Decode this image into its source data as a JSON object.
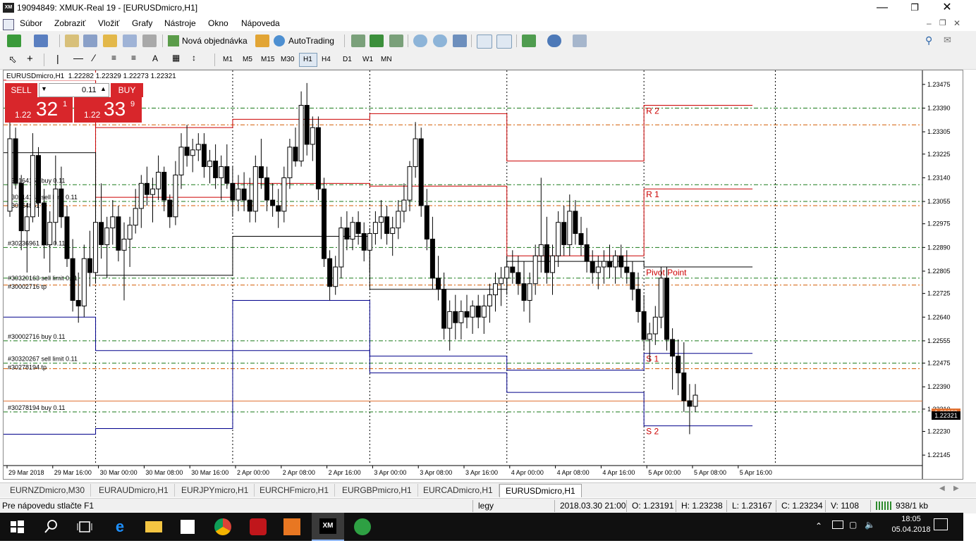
{
  "window": {
    "title": "19094849: XMUK-Real 19 - [EURUSDmicro,H1]",
    "app_icon": "XM"
  },
  "menu": [
    "Súbor",
    "Zobraziť",
    "Vložiť",
    "Grafy",
    "Nástroje",
    "Okno",
    "Nápoveda"
  ],
  "toolbar": {
    "new_order": "Nová objednávka",
    "autotrading": "AutoTrading",
    "timeframes": [
      "M1",
      "M5",
      "M15",
      "M30",
      "H1",
      "H4",
      "D1",
      "W1",
      "MN"
    ],
    "active_timeframe": "H1"
  },
  "chart": {
    "header": "EURUSDmicro,H1  1.22282 1.22329 1.22273 1.22321",
    "symbol": "EURUSDmicro,H1",
    "current_price": "1.22321",
    "ask_price": "1.22339",
    "colors": {
      "bull": "#ffffff",
      "bear": "#000000",
      "resistance": "#cc0000",
      "support": "#00008b",
      "pivot": "#000000",
      "buy_line": "#1a7a1a",
      "sell_limit_line": "#1a7a1a",
      "tp_line": "#d45a00",
      "ask_line": "#e07030"
    },
    "pivot_labels": {
      "r2": "R 2",
      "r1": "R 1",
      "pivot": "Pivot Point",
      "s1": "S 1",
      "s2": "S 2"
    },
    "order_labels": [
      {
        "text": "#30164159 buy 0.11",
        "price": 1.23115
      },
      {
        "text": "#30214147 sell limit 0.11",
        "price": 1.23055
      },
      {
        "text": "#30164861 tp",
        "price": 1.23055
      },
      {
        "text": "#30236961 buy 0.11",
        "price": 1.2289
      },
      {
        "text": "#30320163 sell limit 0.11",
        "price": 1.22765
      },
      {
        "text": "#30002716 tp",
        "price": 1.22765
      },
      {
        "text": "#30002716 buy 0.11",
        "price": 1.22555
      },
      {
        "text": "#30320267 sell limit 0.11",
        "price": 1.22475
      },
      {
        "text": "#30278194 tp",
        "price": 1.22475
      },
      {
        "text": "#30278194 buy 0.11",
        "price": 1.223
      }
    ]
  },
  "trade_panel": {
    "sell_label": "SELL",
    "buy_label": "BUY",
    "lot": "0.11",
    "sell_prefix": "1.22",
    "sell_big": "32",
    "sell_sup": "1",
    "buy_prefix": "1.22",
    "buy_big": "33",
    "buy_sup": "9"
  },
  "chart_data": {
    "type": "candlestick",
    "symbol": "EURUSDmicro",
    "timeframe": "H1",
    "ylim": [
      1.2211,
      1.2351
    ],
    "y_ticks": [
      "1.23475",
      "1.23390",
      "1.23305",
      "1.23225",
      "1.23140",
      "1.23055",
      "1.22975",
      "1.22890",
      "1.22805",
      "1.22725",
      "1.22640",
      "1.22555",
      "1.22475",
      "1.22390",
      "1.22310",
      "1.22230",
      "1.22145"
    ],
    "x_ticks": [
      "29 Mar 2018",
      "29 Mar 16:00",
      "30 Mar 00:00",
      "30 Mar 08:00",
      "30 Mar 16:00",
      "2 Apr 00:00",
      "2 Apr 08:00",
      "2 Apr 16:00",
      "3 Apr 00:00",
      "3 Apr 08:00",
      "3 Apr 16:00",
      "4 Apr 00:00",
      "4 Apr 08:00",
      "4 Apr 16:00",
      "5 Apr 00:00",
      "5 Apr 08:00",
      "5 Apr 16:00"
    ],
    "day_separators": [
      15.5,
      39.5,
      63.5,
      87.5,
      111.5
    ],
    "pivots": [
      {
        "from": -1,
        "to": 15.5,
        "r2": 1.2366,
        "r1": 1.2349,
        "pp": 1.2323,
        "s1": 1.2264,
        "s2": 1.2222
      },
      {
        "from": 15.5,
        "to": 39.5,
        "r2": 1.2332,
        "r1": 1.2307,
        "pp": 1.2279,
        "s1": 1.2252,
        "s2": 1.2224
      },
      {
        "from": 39.5,
        "to": 63.5,
        "r2": 1.2335,
        "r1": 1.2312,
        "pp": 1.2293,
        "s1": 1.227,
        "s2": 1.2252
      },
      {
        "from": 63.5,
        "to": 87.5,
        "r2": 1.2337,
        "r1": 1.2311,
        "pp": 1.2274,
        "s1": 1.225,
        "s2": 1.2244
      },
      {
        "from": 87.5,
        "to": 111.5,
        "r2": 1.232,
        "r1": 1.2286,
        "pp": 1.2284,
        "s1": 1.2245,
        "s2": 1.2237
      },
      {
        "from": 111.5,
        "to": 130.5,
        "r2": 1.234,
        "r1": 1.231,
        "pp": 1.2282,
        "s1": 1.2251,
        "s2": 1.2225
      }
    ],
    "order_lines": [
      {
        "price": 1.2339,
        "kind": "buy"
      },
      {
        "price": 1.2333,
        "kind": "tp"
      },
      {
        "price": 1.23115,
        "kind": "buy"
      },
      {
        "price": 1.23055,
        "kind": "sell_limit"
      },
      {
        "price": 1.2304,
        "kind": "tp"
      },
      {
        "price": 1.2289,
        "kind": "buy"
      },
      {
        "price": 1.2278,
        "kind": "sell_limit"
      },
      {
        "price": 1.22755,
        "kind": "tp"
      },
      {
        "price": 1.22555,
        "kind": "buy"
      },
      {
        "price": 1.22475,
        "kind": "sell_limit"
      },
      {
        "price": 1.22455,
        "kind": "tp"
      },
      {
        "price": 1.223,
        "kind": "buy"
      }
    ],
    "ask_line": 1.22339,
    "candles": [
      [
        1.2302,
        1.2335,
        1.23,
        1.2328
      ],
      [
        1.2328,
        1.2332,
        1.231,
        1.2312
      ],
      [
        1.2312,
        1.2315,
        1.2288,
        1.2295
      ],
      [
        1.2295,
        1.2305,
        1.228,
        1.23
      ],
      [
        1.23,
        1.233,
        1.2298,
        1.2322
      ],
      [
        1.2322,
        1.2325,
        1.23,
        1.2305
      ],
      [
        1.2305,
        1.231,
        1.2285,
        1.229
      ],
      [
        1.229,
        1.2302,
        1.228,
        1.2298
      ],
      [
        1.2298,
        1.2322,
        1.229,
        1.231
      ],
      [
        1.231,
        1.2318,
        1.2296,
        1.23
      ],
      [
        1.23,
        1.2304,
        1.2282,
        1.2285
      ],
      [
        1.2285,
        1.2292,
        1.2266,
        1.227
      ],
      [
        1.227,
        1.228,
        1.2262,
        1.2268
      ],
      [
        1.2268,
        1.229,
        1.2264,
        1.2285
      ],
      [
        1.2285,
        1.2295,
        1.2275,
        1.228
      ],
      [
        1.228,
        1.2305,
        1.2276,
        1.2298
      ],
      [
        1.2298,
        1.2312,
        1.2285,
        1.229
      ],
      [
        1.229,
        1.23,
        1.2278,
        1.2296
      ],
      [
        1.2296,
        1.2306,
        1.229,
        1.23
      ],
      [
        1.23,
        1.2304,
        1.2284,
        1.2288
      ],
      [
        1.2288,
        1.2298,
        1.227,
        1.2292
      ],
      [
        1.2292,
        1.23,
        1.2282,
        1.2297
      ],
      [
        1.2297,
        1.231,
        1.2294,
        1.2303
      ],
      [
        1.2303,
        1.2315,
        1.2296,
        1.2312
      ],
      [
        1.2312,
        1.2318,
        1.2304,
        1.2308
      ],
      [
        1.2308,
        1.2314,
        1.2298,
        1.231
      ],
      [
        1.231,
        1.2322,
        1.2306,
        1.2316
      ],
      [
        1.2316,
        1.2318,
        1.2302,
        1.2306
      ],
      [
        1.2306,
        1.2308,
        1.2296,
        1.23
      ],
      [
        1.23,
        1.232,
        1.2297,
        1.2315
      ],
      [
        1.2315,
        1.233,
        1.231,
        1.2325
      ],
      [
        1.2325,
        1.2333,
        1.2318,
        1.2322
      ],
      [
        1.2322,
        1.2328,
        1.2316,
        1.2324
      ],
      [
        1.2324,
        1.233,
        1.232,
        1.2326
      ],
      [
        1.2326,
        1.233,
        1.2314,
        1.2318
      ],
      [
        1.2318,
        1.2324,
        1.2312,
        1.232
      ],
      [
        1.232,
        1.2326,
        1.231,
        1.2314
      ],
      [
        1.2314,
        1.2322,
        1.2306,
        1.2318
      ],
      [
        1.2318,
        1.2326,
        1.231,
        1.2312
      ],
      [
        1.2312,
        1.2318,
        1.23,
        1.2306
      ],
      [
        1.2306,
        1.2315,
        1.2302,
        1.231
      ],
      [
        1.231,
        1.2316,
        1.2302,
        1.2306
      ],
      [
        1.2306,
        1.2314,
        1.2298,
        1.2302
      ],
      [
        1.2302,
        1.2322,
        1.2298,
        1.2318
      ],
      [
        1.2318,
        1.2328,
        1.231,
        1.2314
      ],
      [
        1.2314,
        1.2318,
        1.2302,
        1.2306
      ],
      [
        1.2306,
        1.2312,
        1.23,
        1.2304
      ],
      [
        1.2304,
        1.231,
        1.2296,
        1.2302
      ],
      [
        1.2302,
        1.2318,
        1.2298,
        1.2314
      ],
      [
        1.2314,
        1.2328,
        1.231,
        1.2325
      ],
      [
        1.2325,
        1.2332,
        1.2318,
        1.232
      ],
      [
        1.232,
        1.2345,
        1.2318,
        1.234
      ],
      [
        1.234,
        1.2348,
        1.2322,
        1.2326
      ],
      [
        1.2326,
        1.2336,
        1.232,
        1.2332
      ],
      [
        1.2332,
        1.2336,
        1.2306,
        1.231
      ],
      [
        1.231,
        1.2314,
        1.2282,
        1.2285
      ],
      [
        1.2285,
        1.2288,
        1.227,
        1.2275
      ],
      [
        1.2275,
        1.2286,
        1.2272,
        1.2282
      ],
      [
        1.2282,
        1.23,
        1.2278,
        1.2296
      ],
      [
        1.2296,
        1.2302,
        1.2288,
        1.2292
      ],
      [
        1.2292,
        1.23,
        1.2288,
        1.2298
      ],
      [
        1.2298,
        1.2302,
        1.229,
        1.2294
      ],
      [
        1.2294,
        1.2298,
        1.2284,
        1.2288
      ],
      [
        1.2288,
        1.2296,
        1.228,
        1.2294
      ],
      [
        1.2294,
        1.2302,
        1.229,
        1.2298
      ],
      [
        1.2298,
        1.2306,
        1.2292,
        1.23
      ],
      [
        1.23,
        1.2304,
        1.229,
        1.2294
      ],
      [
        1.2294,
        1.23,
        1.2286,
        1.2296
      ],
      [
        1.2296,
        1.2306,
        1.2292,
        1.2302
      ],
      [
        1.2302,
        1.2312,
        1.2298,
        1.2306
      ],
      [
        1.2306,
        1.232,
        1.2302,
        1.2318
      ],
      [
        1.2318,
        1.2334,
        1.2314,
        1.2328
      ],
      [
        1.2328,
        1.2332,
        1.23,
        1.2304
      ],
      [
        1.2304,
        1.231,
        1.2288,
        1.2292
      ],
      [
        1.2292,
        1.23,
        1.2274,
        1.2278
      ],
      [
        1.2278,
        1.2286,
        1.227,
        1.2274
      ],
      [
        1.2274,
        1.228,
        1.2256,
        1.226
      ],
      [
        1.226,
        1.227,
        1.2252,
        1.2266
      ],
      [
        1.2266,
        1.2272,
        1.2256,
        1.2262
      ],
      [
        1.2262,
        1.227,
        1.2256,
        1.2266
      ],
      [
        1.2266,
        1.2272,
        1.226,
        1.2264
      ],
      [
        1.2264,
        1.227,
        1.2258,
        1.2268
      ],
      [
        1.2268,
        1.2272,
        1.226,
        1.2264
      ],
      [
        1.2264,
        1.2272,
        1.2258,
        1.2268
      ],
      [
        1.2268,
        1.2276,
        1.2262,
        1.2272
      ],
      [
        1.2272,
        1.228,
        1.2266,
        1.2276
      ],
      [
        1.2276,
        1.2282,
        1.2268,
        1.2278
      ],
      [
        1.2278,
        1.2286,
        1.2272,
        1.2282
      ],
      [
        1.2282,
        1.2288,
        1.2276,
        1.228
      ],
      [
        1.228,
        1.2286,
        1.2272,
        1.2276
      ],
      [
        1.2276,
        1.2284,
        1.2266,
        1.227
      ],
      [
        1.227,
        1.228,
        1.2262,
        1.2276
      ],
      [
        1.2276,
        1.229,
        1.2272,
        1.2286
      ],
      [
        1.2286,
        1.2314,
        1.228,
        1.229
      ],
      [
        1.229,
        1.23,
        1.2276,
        1.228
      ],
      [
        1.228,
        1.229,
        1.2272,
        1.2286
      ],
      [
        1.2286,
        1.2302,
        1.2282,
        1.2298
      ],
      [
        1.2298,
        1.2304,
        1.2286,
        1.229
      ],
      [
        1.229,
        1.2308,
        1.2286,
        1.2302
      ],
      [
        1.2302,
        1.2306,
        1.229,
        1.2294
      ],
      [
        1.2294,
        1.23,
        1.2286,
        1.229
      ],
      [
        1.229,
        1.2296,
        1.228,
        1.2284
      ],
      [
        1.2284,
        1.2288,
        1.2276,
        1.228
      ],
      [
        1.228,
        1.2286,
        1.2274,
        1.2282
      ],
      [
        1.2282,
        1.2288,
        1.2276,
        1.2284
      ],
      [
        1.2284,
        1.229,
        1.2278,
        1.2282
      ],
      [
        1.2282,
        1.2288,
        1.2276,
        1.2286
      ],
      [
        1.2286,
        1.229,
        1.2278,
        1.2282
      ],
      [
        1.2282,
        1.2288,
        1.2276,
        1.228
      ],
      [
        1.228,
        1.2284,
        1.227,
        1.2274
      ],
      [
        1.2274,
        1.228,
        1.2262,
        1.2266
      ],
      [
        1.2266,
        1.2272,
        1.2252,
        1.2256
      ],
      [
        1.2256,
        1.2262,
        1.2248,
        1.2258
      ],
      [
        1.2258,
        1.2268,
        1.2254,
        1.2264
      ],
      [
        1.2264,
        1.2282,
        1.226,
        1.2278
      ],
      [
        1.2278,
        1.2282,
        1.2252,
        1.2256
      ],
      [
        1.2256,
        1.226,
        1.2238,
        1.225
      ],
      [
        1.225,
        1.2256,
        1.2236,
        1.2244
      ],
      [
        1.2244,
        1.2255,
        1.223,
        1.2234
      ],
      [
        1.2234,
        1.224,
        1.2222,
        1.2232
      ],
      [
        1.2232,
        1.224,
        1.223,
        1.2236
      ]
    ]
  },
  "tabs": [
    "EURNZDmicro,M30",
    "EURAUDmicro,H1",
    "EURJPYmicro,H1",
    "EURCHFmicro,H1",
    "EURGBPmicro,H1",
    "EURCADmicro,H1",
    "EURUSDmicro,H1"
  ],
  "active_tab": "EURUSDmicro,H1",
  "status": {
    "help": "Pre nápovedu stlačte F1",
    "profile": "legy",
    "datetime": "2018.03.30 21:00",
    "open": "O: 1.23191",
    "high": "H: 1.23238",
    "low": "L: 1.23167",
    "close": "C: 1.23234",
    "volume": "V: 1108",
    "traffic": "938/1 kb"
  },
  "taskbar": {
    "time": "18:05",
    "date": "05.04.2018",
    "icons": [
      "start-icon",
      "search-icon",
      "task-view-icon",
      "edge-icon",
      "explorer-icon",
      "store-icon",
      "chrome-icon",
      "app-red-icon",
      "app-orange-icon",
      "xm-icon",
      "app-green-icon"
    ]
  }
}
